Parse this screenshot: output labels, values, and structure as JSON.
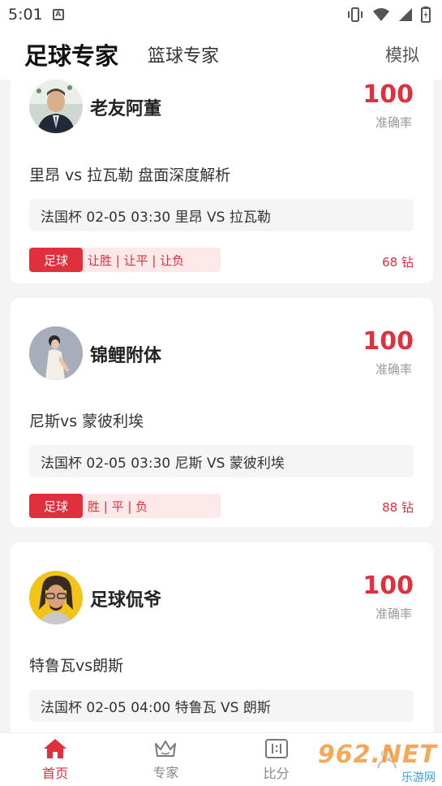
{
  "status_bar": {
    "time": "5:01",
    "a_icon": "A"
  },
  "top_nav": {
    "tab_football": "足球专家",
    "tab_basketball": "篮球专家",
    "simulate": "模拟"
  },
  "cards": [
    {
      "name": "老友阿董",
      "accuracy": "100",
      "accuracy_label": "准确率",
      "match_title": "里昂 vs 拉瓦勒 盘面深度解析",
      "match_info": "法国杯 02-05 03:30 里昂 VS 拉瓦勒",
      "sport": "足球",
      "bet_types": "让胜 | 让平 | 让负",
      "price": "68 钻"
    },
    {
      "name": "锦鲤附体",
      "accuracy": "100",
      "accuracy_label": "准确率",
      "match_title": "尼斯vs 蒙彼利埃",
      "match_info": "法国杯 02-05 03:30 尼斯 VS 蒙彼利埃",
      "sport": "足球",
      "bet_types": "胜 | 平 | 负",
      "price": "88 钻"
    },
    {
      "name": "足球侃爷",
      "accuracy": "100",
      "accuracy_label": "准确率",
      "match_title": "特鲁瓦vs朗斯",
      "match_info": "法国杯 02-05 04:00 特鲁瓦 VS 朗斯"
    }
  ],
  "bottom_nav": {
    "home": "首页",
    "experts": "专家",
    "scores": "比分"
  },
  "watermark": {
    "main": "962.NET",
    "sub": "乐游网"
  },
  "colors": {
    "accent": "#e0303d",
    "tag_bg": "#fde8ea"
  }
}
